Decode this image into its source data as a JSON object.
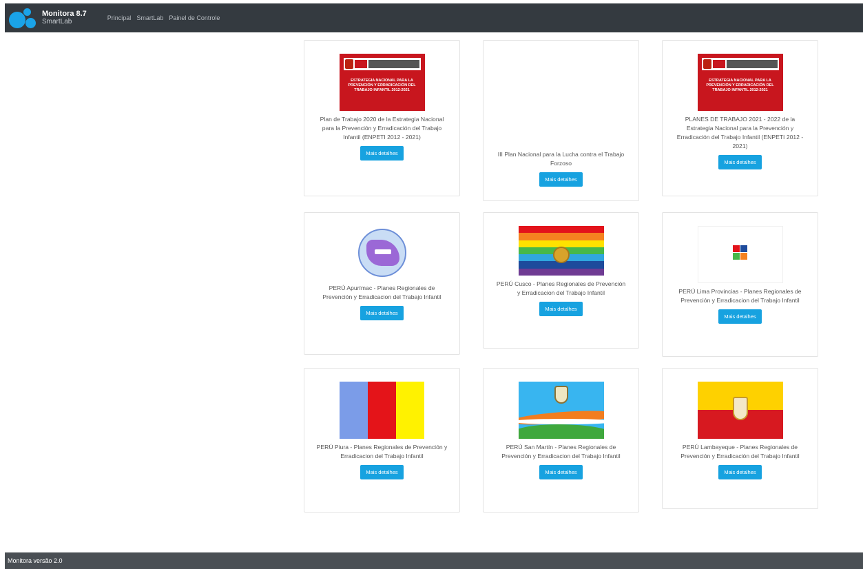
{
  "header": {
    "app_title": "Monitora 8.7",
    "app_subtitle": "SmartLab",
    "nav": [
      "Principal",
      "SmartLab",
      "Painel de Controle"
    ]
  },
  "footer": {
    "text": "Monitora versão 2.0"
  },
  "cover_lettering": {
    "enpeti": "ESTRATEGIA NACIONAL PARA LA PREVENCIÓN Y ERRADICACIÓN DEL TRABAJO INFANTIL 2012-2021"
  },
  "cards": [
    {
      "title": "Plan de Trabajo 2020 de la Estrategia Nacional para la Prevención y Erradicación del Trabajo Infantil (ENPETI 2012 - 2021)",
      "button": "Mais detalhes",
      "image": "enpeti-cover"
    },
    {
      "title": "III Plan Nacional para la Lucha contra el Trabajo Forzoso",
      "button": "Mais detalhes",
      "image": "none"
    },
    {
      "title": "PLANES DE TRABAJO 2021 - 2022 de la Estrategia Nacional para la Prevención y Erradicación del Trabajo Infantil (ENPETI 2012 - 2021)",
      "button": "Mais detalhes",
      "image": "enpeti-cover"
    },
    {
      "title": "PERÚ Apurímac - Planes Regionales de Prevención y Erradicacion del Trabajo Infantil",
      "button": "Mais detalhes",
      "image": "apurimac-badge"
    },
    {
      "title": "PERÚ Cusco - Planes Regionales de Prevención y Erradicacion del Trabajo Infantil",
      "button": "Mais detalhes",
      "image": "cusco-flag"
    },
    {
      "title": "PERÚ Lima Provincias - Planes Regionales de Prevención y Erradicacion del Trabajo Infantil",
      "button": "Mais detalhes",
      "image": "lima-provincias-logo"
    },
    {
      "title": "PERÚ Piura - Planes Regionales de Prevención y Erradicacion del Trabajo Infantil",
      "button": "Mais detalhes",
      "image": "piura-flag"
    },
    {
      "title": "PERÚ San Martín - Planes Regionales de Prevención y Erradicacion del Trabajo Infantil",
      "button": "Mais detalhes",
      "image": "san-martin-flag"
    },
    {
      "title": "PERÚ Lambayeque - Planes Regionales de Prevención y Erradicación del Trabajo Infantil",
      "button": "Mais detalhes",
      "image": "lambayeque-flag"
    }
  ],
  "colors": {
    "topbar": "#343a40",
    "footer": "#4a4f54",
    "button": "#17a2e0",
    "logo": "#1aa3e8"
  }
}
